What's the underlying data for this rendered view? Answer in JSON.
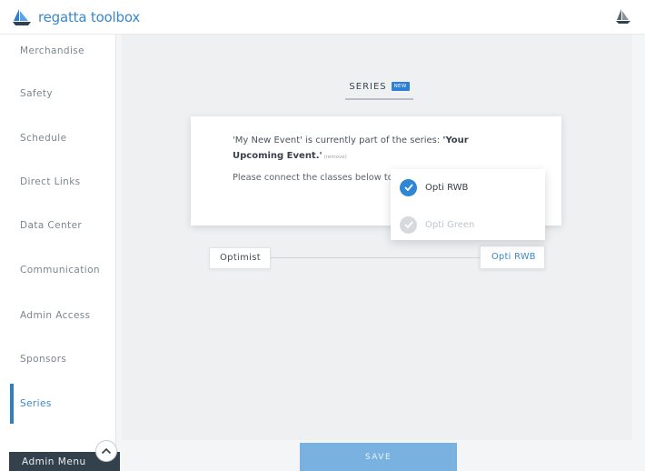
{
  "app": {
    "logo_text": "regatta toolbox"
  },
  "sidebar": {
    "items": [
      {
        "label": "Merchandise",
        "active": false
      },
      {
        "label": "Safety",
        "active": false
      },
      {
        "label": "Schedule",
        "active": false
      },
      {
        "label": "Direct Links",
        "active": false
      },
      {
        "label": "Data Center",
        "active": false
      },
      {
        "label": "Communication",
        "active": false
      },
      {
        "label": "Admin Access",
        "active": false
      },
      {
        "label": "Sponsors",
        "active": false
      },
      {
        "label": "Series",
        "active": true
      }
    ],
    "admin_menu_label": "Admin Menu"
  },
  "tab": {
    "label": "SERIES",
    "badge": "NEW"
  },
  "series_card": {
    "line1_prefix": "'My New Event' is currently part of the series: ",
    "line1_series": "'Your Upcoming Event.'",
    "remove_label": "(remove)",
    "line2": "Please connect the classes below to the boat class for 'My New Event' is the corresponding class in the overall..."
  },
  "class_mapping": {
    "source_class": "Optimist",
    "selected_target": "Opti RWB",
    "options": [
      {
        "label": "Opti RWB",
        "selected": true
      },
      {
        "label": "Opti Green",
        "selected": false,
        "disabled": true
      }
    ]
  },
  "actions": {
    "save_label": "SAVE"
  },
  "colors": {
    "accent": "#2d86d6",
    "sidebar_dark": "#33414d",
    "save_button": "#79b2e1"
  }
}
